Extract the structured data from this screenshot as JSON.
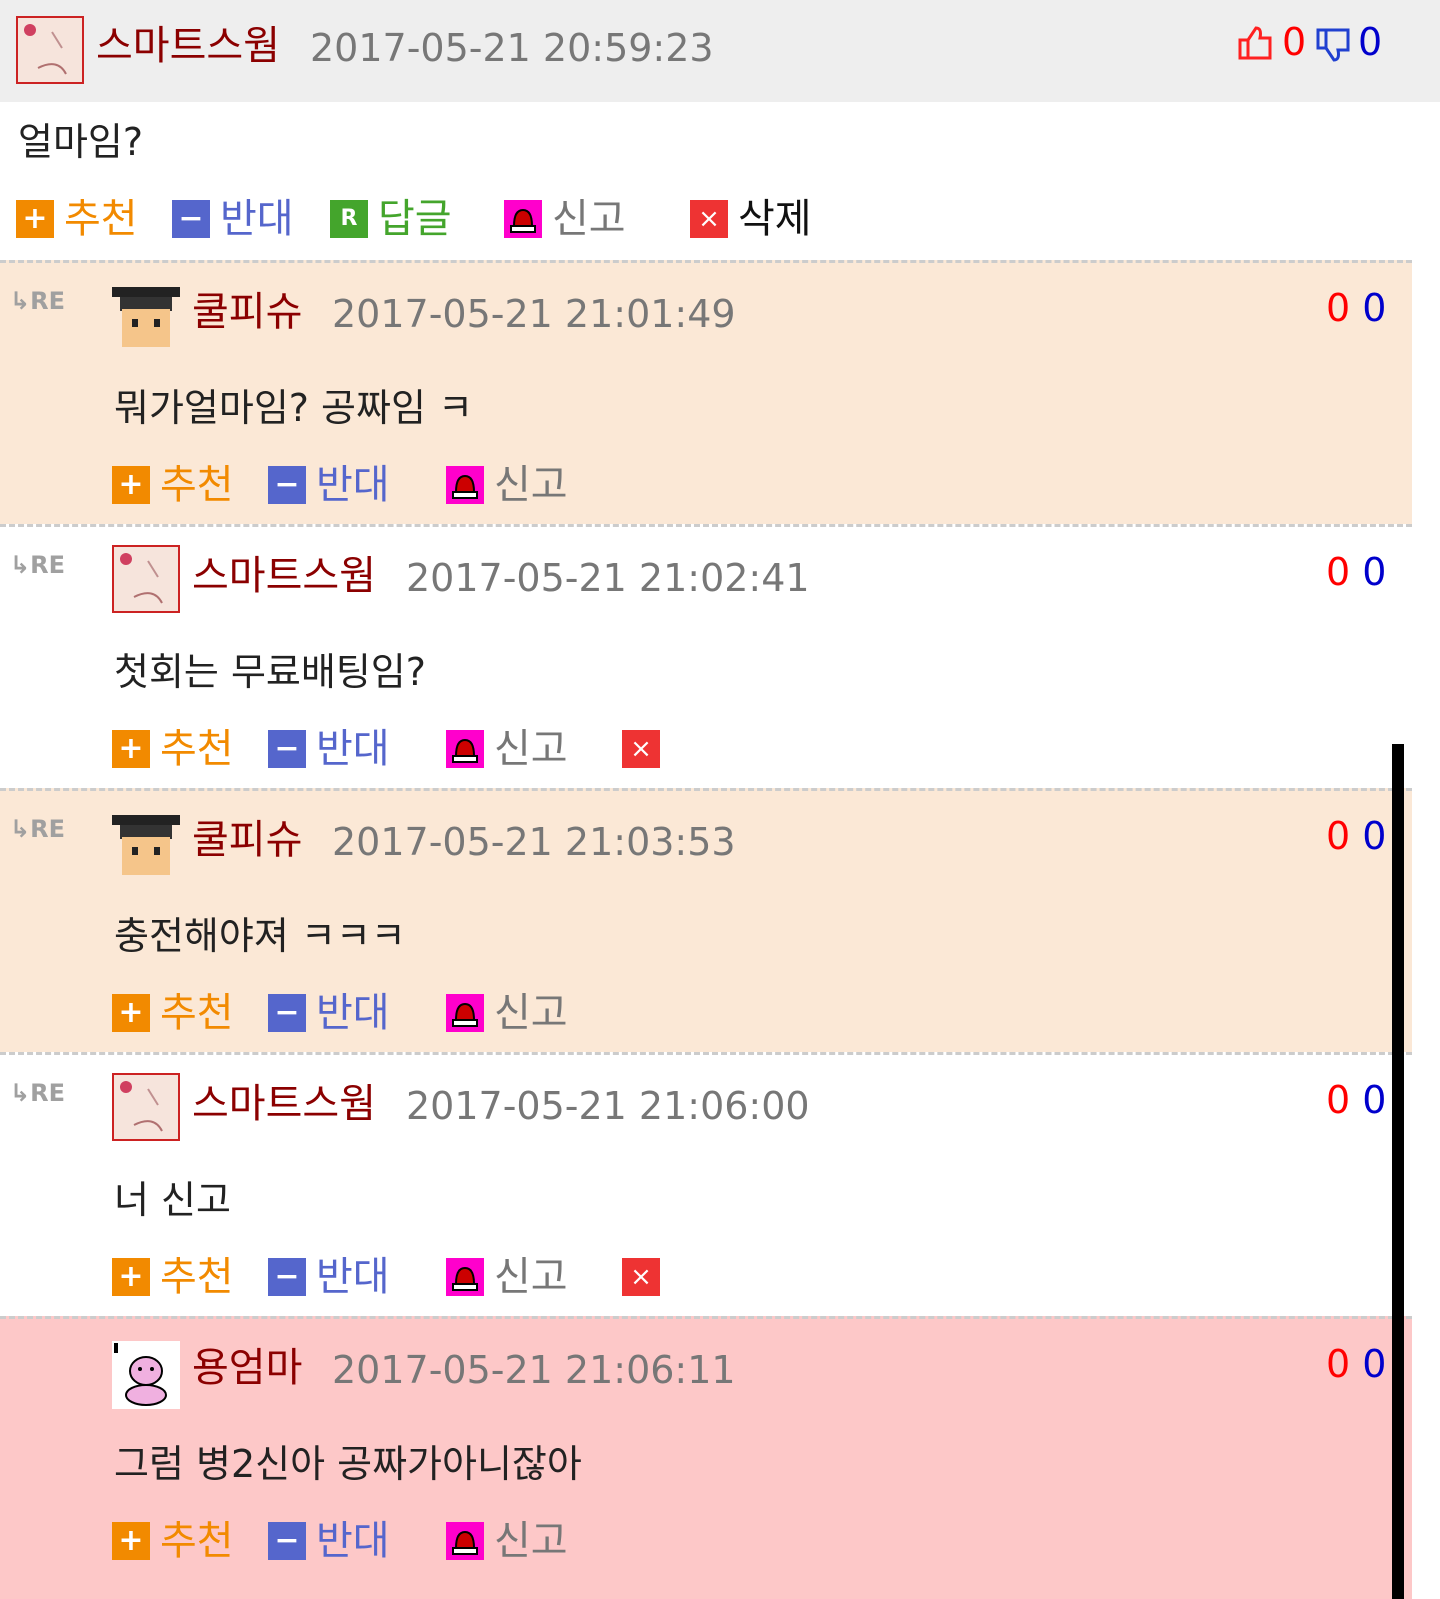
{
  "post": {
    "nick": "스마트스웜",
    "date": "2017-05-21 20:59:23",
    "up": "0",
    "down": "0",
    "text": "얼마임?",
    "actions": {
      "recommend": "추천",
      "oppose": "반대",
      "reply": "답글",
      "report": "신고",
      "delete": "삭제"
    }
  },
  "re_label": "RE",
  "replies": [
    {
      "nick": "쿨피슈",
      "date": "2017-05-21 21:01:49",
      "up": "0",
      "down": "0",
      "text": "뭐가얼마임? 공짜임 ㅋ",
      "recommend": "추천",
      "oppose": "반대",
      "report": "신고"
    },
    {
      "nick": "스마트스웜",
      "date": "2017-05-21 21:02:41",
      "up": "0",
      "down": "0",
      "text": "첫회는 무료배팅임?",
      "recommend": "추천",
      "oppose": "반대",
      "report": "신고"
    },
    {
      "nick": "쿨피슈",
      "date": "2017-05-21 21:03:53",
      "up": "0",
      "down": "0",
      "text": "충전해야져 ㅋㅋㅋ",
      "recommend": "추천",
      "oppose": "반대",
      "report": "신고"
    },
    {
      "nick": "스마트스웜",
      "date": "2017-05-21 21:06:00",
      "up": "0",
      "down": "0",
      "text": "너 신고",
      "recommend": "추천",
      "oppose": "반대",
      "report": "신고"
    },
    {
      "nick": "용엄마",
      "date": "2017-05-21 21:06:11",
      "up": "0",
      "down": "0",
      "text": "그럼 병2신아 공짜가아니잖아",
      "recommend": "추천",
      "oppose": "반대",
      "report": "신고"
    }
  ],
  "colors": {
    "header_bg": "#eeeeee",
    "peach": "#fbe8d6",
    "pink": "#fdc8c8",
    "nick": "#8b0000",
    "recommend": "#f28a00",
    "oppose": "#5566cc",
    "reply": "#44a52c",
    "report_icon": "#ff00cc",
    "delete_icon": "#ee3333"
  },
  "icons": {
    "thumbs_up": "thumbs-up-icon",
    "thumbs_down": "thumbs-down-icon",
    "plus": "plus-icon",
    "minus": "minus-icon",
    "reply": "reply-icon",
    "report": "siren-icon",
    "delete": "close-icon"
  }
}
